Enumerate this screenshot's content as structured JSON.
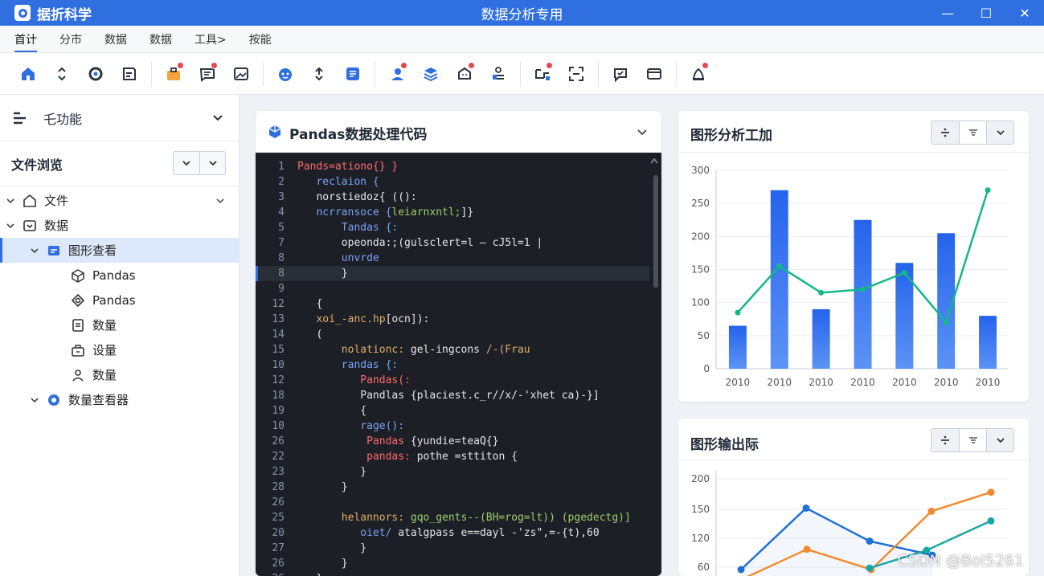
{
  "window": {
    "app_name": "据折科学",
    "title": "数据分析专用",
    "minimize": "—",
    "maximize": "☐",
    "close": "✕"
  },
  "menu": [
    "首计",
    "分市",
    "数据",
    "数据",
    "工具>",
    "按能"
  ],
  "toolbar": [
    "home-icon",
    "chevrons-icon",
    "sync-icon",
    "note-icon",
    "briefcase-icon",
    "message-icon",
    "image-icon",
    "bot-icon",
    "sort-icon",
    "list-icon",
    "user-pin-icon",
    "layers-icon",
    "bell-face-icon",
    "tasks-icon",
    "flow-icon",
    "scan-icon",
    "chat-icon",
    "card-icon",
    "alert-icon"
  ],
  "sidebar": {
    "header_label": "乇功能",
    "file_browser_label": "文件浏览",
    "tree": [
      {
        "label": "文件",
        "icon": "home-icon",
        "level": 0,
        "expanded": true
      },
      {
        "label": "数据",
        "icon": "database-icon",
        "level": 0,
        "expanded": true
      },
      {
        "label": "图形查看",
        "icon": "chart-folder-icon",
        "level": 1,
        "expanded": true,
        "selected": true
      },
      {
        "label": "Pandas",
        "icon": "cube-icon",
        "level": 2
      },
      {
        "label": "Pandas",
        "icon": "layers-icon",
        "level": 2
      },
      {
        "label": "数量",
        "icon": "document-icon",
        "level": 2
      },
      {
        "label": "设量",
        "icon": "box-icon",
        "level": 2
      },
      {
        "label": "数量",
        "icon": "user-icon",
        "level": 2
      },
      {
        "label": "数量查看器",
        "icon": "gear-icon",
        "level": 1,
        "expanded": true
      }
    ]
  },
  "code_panel": {
    "title": "Pandas数据处理代码",
    "lines": [
      {
        "n": "1",
        "segs": [
          {
            "t": "Pands=ationo{} }",
            "c": "#ff6b6b"
          }
        ]
      },
      {
        "n": "2",
        "segs": [
          {
            "t": "   reclaion {",
            "c": "#7aa2f7"
          }
        ]
      },
      {
        "n": "3",
        "segs": [
          {
            "t": "   norstiedoz{ (",
            "c": "#e6e6e6"
          },
          {
            "t": "():",
            "c": "#e6e6e6"
          }
        ]
      },
      {
        "n": "4",
        "segs": [
          {
            "t": "   ncrransoce {",
            "c": "#7aa2f7"
          },
          {
            "t": "leiarnxntl;",
            "c": "#9ece6a"
          },
          {
            "t": "]}",
            "c": "#e6e6e6"
          }
        ]
      },
      {
        "n": "5",
        "segs": [
          {
            "t": "       Tandas {:",
            "c": "#7aa2f7"
          }
        ]
      },
      {
        "n": "7",
        "segs": [
          {
            "t": "       opeonda:;(gulsclert=l – cJ5l=1 |",
            "c": "#e6e6e6"
          }
        ]
      },
      {
        "n": "8",
        "segs": [
          {
            "t": "       unvrde",
            "c": "#7aa2f7"
          }
        ]
      },
      {
        "n": "8",
        "segs": [
          {
            "t": "       }",
            "c": "#e6e6e6"
          }
        ],
        "hl": true
      },
      {
        "n": "9",
        "segs": [
          {
            "t": "",
            "c": "#e6e6e6"
          }
        ]
      },
      {
        "n": "12",
        "segs": [
          {
            "t": "   {",
            "c": "#e6e6e6"
          }
        ]
      },
      {
        "n": "13",
        "segs": [
          {
            "t": "   xoi_-anc.hp",
            "c": "#e0af68"
          },
          {
            "t": "[ocn]):",
            "c": "#e6e6e6"
          }
        ]
      },
      {
        "n": "14",
        "segs": [
          {
            "t": "   (",
            "c": "#e6e6e6"
          }
        ]
      },
      {
        "n": "15",
        "segs": [
          {
            "t": "       nolationc: ",
            "c": "#e0af68"
          },
          {
            "t": "gel-ingcons ",
            "c": "#e6e6e6"
          },
          {
            "t": "/-(Frau",
            "c": "#e0af68"
          }
        ]
      },
      {
        "n": "10",
        "segs": [
          {
            "t": "       randas {:",
            "c": "#7aa2f7"
          }
        ]
      },
      {
        "n": "12",
        "segs": [
          {
            "t": "          Pandas(:",
            "c": "#ff6b6b"
          }
        ]
      },
      {
        "n": "18",
        "segs": [
          {
            "t": "          Pandlas {placiest.c_r//x/-'xhet ca)-}]",
            "c": "#e6e6e6"
          }
        ]
      },
      {
        "n": "19",
        "segs": [
          {
            "t": "          {",
            "c": "#e6e6e6"
          }
        ]
      },
      {
        "n": "10",
        "segs": [
          {
            "t": "          rage():",
            "c": "#7aa2f7"
          }
        ]
      },
      {
        "n": "26",
        "segs": [
          {
            "t": "           Pandas ",
            "c": "#ff6b6b"
          },
          {
            "t": "{yundie=teaQ{}",
            "c": "#e6e6e6"
          }
        ]
      },
      {
        "n": "22",
        "segs": [
          {
            "t": "           pandas: ",
            "c": "#ff6b6b"
          },
          {
            "t": "pothe =sttiton {",
            "c": "#e6e6e6"
          }
        ]
      },
      {
        "n": "23",
        "segs": [
          {
            "t": "          }",
            "c": "#e6e6e6"
          }
        ]
      },
      {
        "n": "28",
        "segs": [
          {
            "t": "       }",
            "c": "#e6e6e6"
          }
        ]
      },
      {
        "n": "26",
        "segs": [
          {
            "t": "",
            "c": "#e6e6e6"
          }
        ]
      },
      {
        "n": "25",
        "segs": [
          {
            "t": "       helannors: ",
            "c": "#e0af68"
          },
          {
            "t": "gqo_gents--(BH=rog=lt)) (pgedectg)]",
            "c": "#9ece6a"
          }
        ]
      },
      {
        "n": "20",
        "segs": [
          {
            "t": "          oiet/ ",
            "c": "#7aa2f7"
          },
          {
            "t": "atalgpass e==dayl -'zs\",=-{t),60",
            "c": "#e6e6e6"
          }
        ]
      },
      {
        "n": "27",
        "segs": [
          {
            "t": "          }",
            "c": "#e6e6e6"
          }
        ]
      },
      {
        "n": "26",
        "segs": [
          {
            "t": "       }",
            "c": "#e6e6e6"
          }
        ]
      },
      {
        "n": "26",
        "segs": [
          {
            "t": "   }",
            "c": "#e6e6e6"
          }
        ]
      }
    ]
  },
  "chart_panel_1": {
    "title": "图形分析工加"
  },
  "chart_panel_2": {
    "title": "图形输出际"
  },
  "chart_data": [
    {
      "type": "bar",
      "title": "图形分析工加",
      "categories": [
        "2010",
        "2010",
        "2010",
        "2010",
        "2010",
        "2010",
        "2010"
      ],
      "series": [
        {
          "type": "bar",
          "values": [
            65,
            270,
            90,
            225,
            160,
            205,
            80
          ],
          "color": "#2f6fe0"
        },
        {
          "type": "line",
          "values": [
            85,
            155,
            115,
            120,
            145,
            70,
            270
          ],
          "color": "#12b886"
        }
      ],
      "y_ticks": [
        0,
        50,
        100,
        150,
        200,
        250,
        300
      ],
      "ylim": [
        0,
        300
      ],
      "grid": true
    },
    {
      "type": "line",
      "title": "图形输出际",
      "y_ticks": [
        60,
        120,
        150,
        200
      ],
      "series": [
        {
          "values": [
            55,
            152,
            114,
            85
          ],
          "color": "#1f6fd6"
        },
        {
          "values": [
            34,
            97,
            55,
            148,
            178
          ],
          "color": "#f08c2e"
        },
        {
          "values": [
            58,
            95,
            138
          ],
          "color": "#1aa6a6"
        }
      ],
      "grid": true
    }
  ],
  "watermark": "CSDN @Bol5261"
}
